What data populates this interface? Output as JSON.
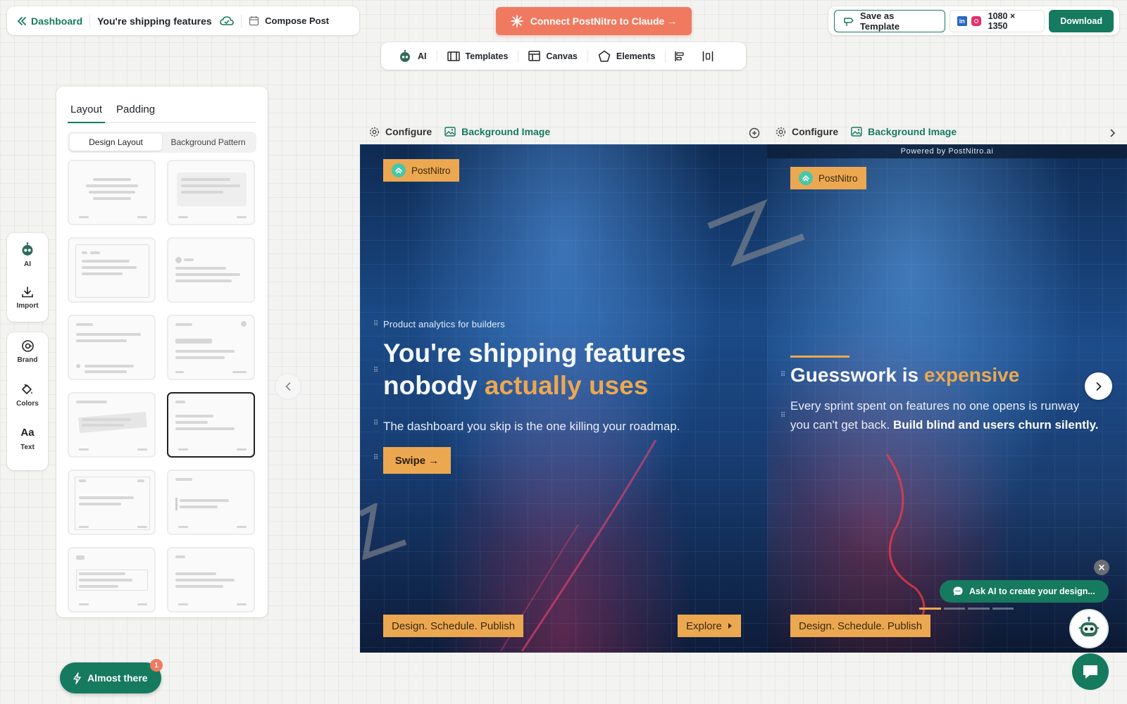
{
  "header": {
    "back_label": "Dashboard",
    "document_title": "You're shipping features nobody actually uses",
    "compose_label": "Compose Post",
    "connect_label": "Connect PostNitro to Claude →",
    "save_template_label": "Save as Template",
    "size_label": "1080 × 1350",
    "download_label": "Download"
  },
  "toolbar": {
    "ai": "AI",
    "templates": "Templates",
    "canvas": "Canvas",
    "elements": "Elements"
  },
  "rail": {
    "ai": "AI",
    "import": "Import",
    "brand": "Brand",
    "colors": "Colors",
    "text": "Text"
  },
  "panel": {
    "tabs": [
      "Layout",
      "Padding"
    ],
    "segments": [
      "Design Layout",
      "Background Pattern"
    ],
    "selected_layout_index": 7
  },
  "slide_headers": {
    "configure": "Configure",
    "background_image": "Background Image"
  },
  "slide1": {
    "brand": "PostNitro",
    "eyebrow": "Product analytics for builders",
    "headline_part1": "You're shipping features nobody ",
    "headline_accent": "actually uses",
    "subline": "The dashboard you skip is the one killing your roadmap.",
    "cta": "Swipe →",
    "footer_tag": "Design. Schedule. Publish",
    "explore": "Explore"
  },
  "slide2": {
    "powered_by": "Powered by PostNitro.ai",
    "brand": "PostNitro",
    "headline_part1": "Guesswork is ",
    "headline_accent": "expensive",
    "body_line1": "Every sprint spent on features no one opens is runway",
    "body_line2_plain": "you can't get back. ",
    "body_line2_bold": "Build blind and users churn silently.",
    "footer_tag": "Design. Schedule. Publish"
  },
  "widgets": {
    "ask_ai": "Ask AI to create your design...",
    "almost_there": "Almost there",
    "badge_count": "1"
  },
  "colors": {
    "brand_green": "#167a5f",
    "connect_coral": "#f07a5f",
    "accent_amber": "#eca851"
  }
}
